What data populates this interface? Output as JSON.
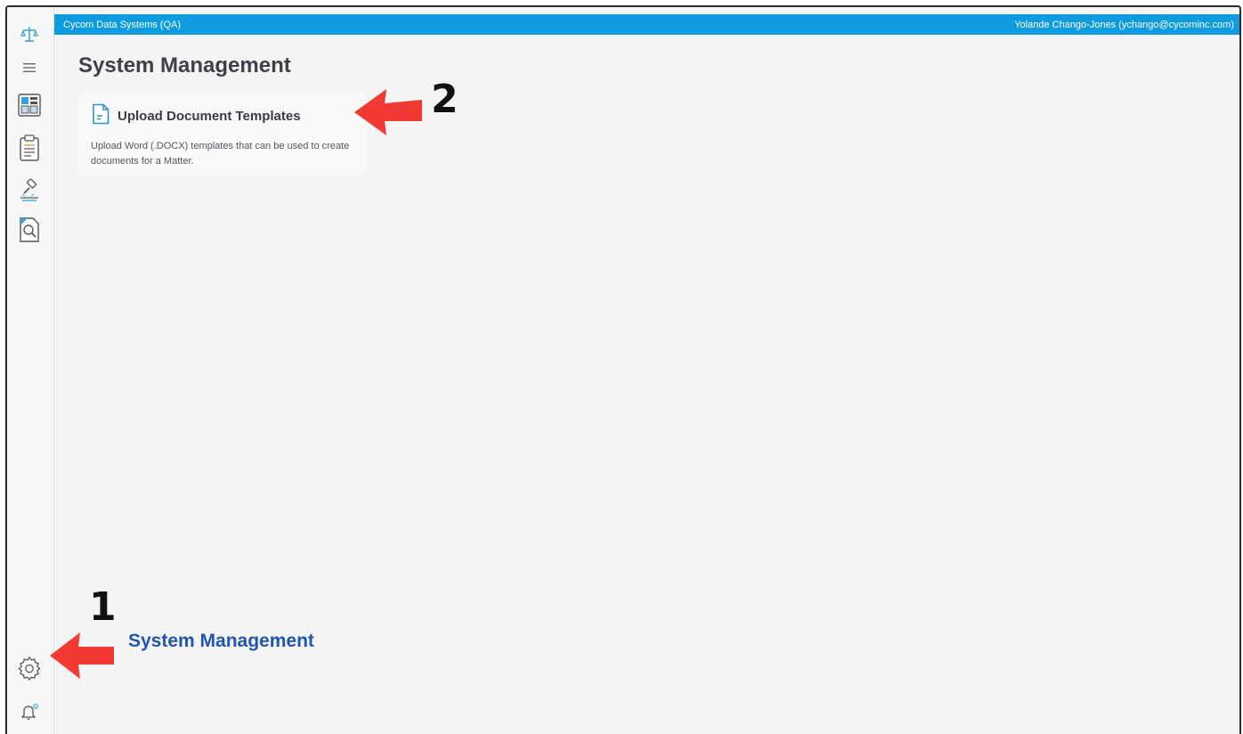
{
  "topbar": {
    "org": "Cycom Data Systems (QA)",
    "user": "Yolande Chango-Jones (ychango@cycominc.com)"
  },
  "page": {
    "title": "System Management"
  },
  "card": {
    "title": "Upload Document Templates",
    "description": "Upload Word (.DOCX) templates that can be used to create documents for a Matter."
  },
  "sidebar": {
    "icons": [
      "scales-logo-icon",
      "hamburger-menu-icon",
      "dashboard-icon",
      "clipboard-icon",
      "gavel-icon",
      "document-search-icon",
      "gear-icon",
      "bell-icon"
    ]
  },
  "annotations": {
    "step1_number": "1",
    "step1_label": "System Management",
    "step2_number": "2",
    "arrow_color": "#f23a35"
  }
}
